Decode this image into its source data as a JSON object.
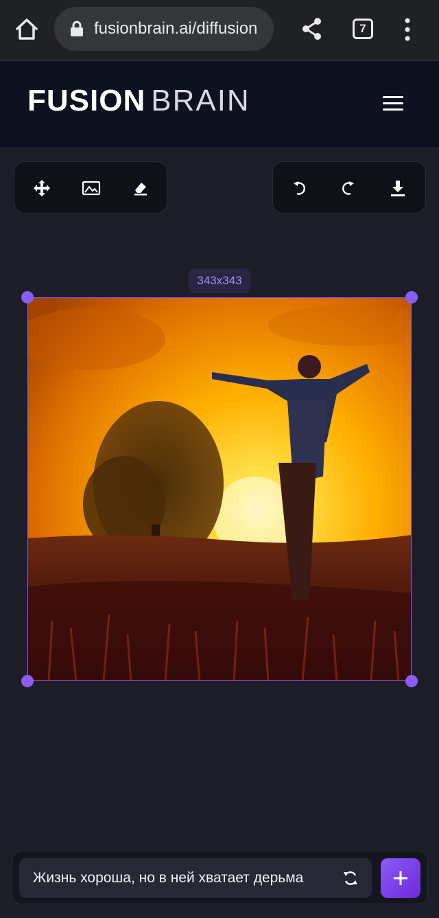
{
  "browser": {
    "url": "fusionbrain.ai/diffusion",
    "tab_count": "7"
  },
  "header": {
    "logo_bold": "FUSION",
    "logo_light": "BRAIN"
  },
  "toolbar_left": {
    "icons": [
      "move-icon",
      "image-icon",
      "eraser-icon"
    ]
  },
  "toolbar_right": {
    "icons": [
      "undo-icon",
      "redo-icon",
      "download-icon"
    ]
  },
  "canvas": {
    "size_label": "343x343",
    "accent": "#8b5cf6"
  },
  "prompt": {
    "text": "Жизнь хороша, но в ней хватает дерьма"
  }
}
